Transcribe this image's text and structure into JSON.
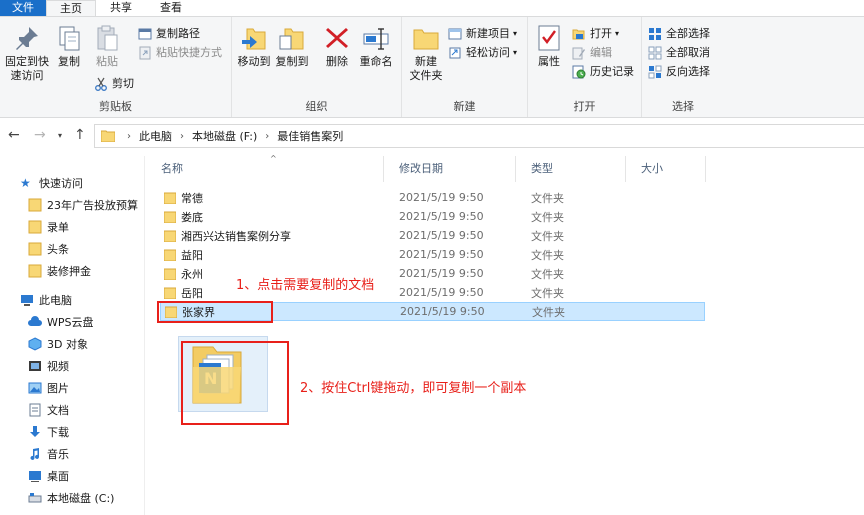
{
  "tabs": {
    "file": "文件",
    "home": "主页",
    "share": "共享",
    "view": "查看"
  },
  "ribbon": {
    "clipboard": {
      "label": "剪贴板",
      "pin": "固定到快\n速访问",
      "copy": "复制",
      "paste": "粘贴",
      "copy_path": "复制路径",
      "paste_shortcut": "粘贴快捷方式",
      "cut": "剪切"
    },
    "organize": {
      "label": "组织",
      "move_to": "移动到",
      "copy_to": "复制到",
      "delete": "删除",
      "rename": "重命名"
    },
    "new": {
      "label": "新建",
      "new_folder": "新建\n文件夹",
      "new_item": "新建项目",
      "easy_access": "轻松访问"
    },
    "open": {
      "label": "打开",
      "properties": "属性",
      "open": "打开",
      "edit": "编辑",
      "history": "历史记录"
    },
    "select": {
      "label": "选择",
      "select_all": "全部选择",
      "select_none": "全部取消",
      "invert": "反向选择"
    }
  },
  "address": {
    "crumbs": [
      "此电脑",
      "本地磁盘 (F:)",
      "最佳销售案列"
    ]
  },
  "nav": {
    "quick_access": "快速访问",
    "pinned": [
      "23年广告投放预算",
      "录单",
      "头条",
      "装修押金"
    ],
    "this_pc": "此电脑",
    "pc_items": [
      "WPS云盘",
      "3D 对象",
      "视频",
      "图片",
      "文档",
      "下载",
      "音乐",
      "桌面",
      "本地磁盘 (C:)"
    ]
  },
  "columns": {
    "name": "名称",
    "date": "修改日期",
    "type": "类型",
    "size": "大小"
  },
  "files": [
    {
      "name": "常德",
      "date": "2021/5/19 9:50",
      "type": "文件夹"
    },
    {
      "name": "娄底",
      "date": "2021/5/19 9:50",
      "type": "文件夹"
    },
    {
      "name": "湘西兴达销售案例分享",
      "date": "2021/5/19 9:50",
      "type": "文件夹"
    },
    {
      "name": "益阳",
      "date": "2021/5/19 9:50",
      "type": "文件夹"
    },
    {
      "name": "永州",
      "date": "2021/5/19 9:50",
      "type": "文件夹"
    },
    {
      "name": "岳阳",
      "date": "2021/5/19 9:50",
      "type": "文件夹"
    },
    {
      "name": "张家界",
      "date": "2021/5/19 9:50",
      "type": "文件夹"
    }
  ],
  "annotations": {
    "step1": "1、点击需要复制的文档",
    "step2": "2、按住Ctrl键拖动，即可复制一个副本"
  },
  "colors": {
    "file_tab": "#1a6fc9",
    "selection": "#cce8ff",
    "annotation": "#e8201a",
    "folder": "#f8d775"
  }
}
